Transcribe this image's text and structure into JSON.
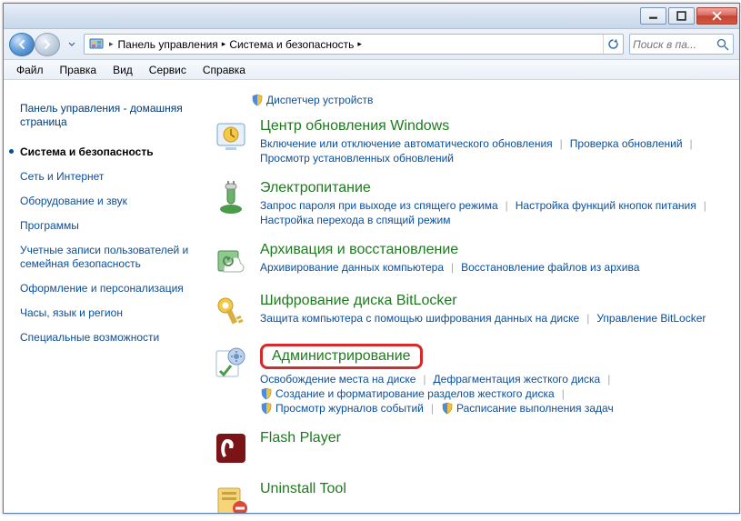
{
  "window": {
    "title": ""
  },
  "nav": {
    "breadcrumb": [
      "Панель управления",
      "Система и безопасность"
    ],
    "search_placeholder": "Поиск в па..."
  },
  "menu": [
    "Файл",
    "Правка",
    "Вид",
    "Сервис",
    "Справка"
  ],
  "sidebar": {
    "home": "Панель управления - домашняя страница",
    "items": [
      {
        "label": "Система и безопасность",
        "active": true
      },
      {
        "label": "Сеть и Интернет"
      },
      {
        "label": "Оборудование и звук"
      },
      {
        "label": "Программы"
      },
      {
        "label": "Учетные записи пользователей и семейная безопасность"
      },
      {
        "label": "Оформление и персонализация"
      },
      {
        "label": "Часы, язык и регион"
      },
      {
        "label": "Специальные возможности"
      }
    ]
  },
  "top_orphan": {
    "shield": true,
    "label": "Диспетчер устройств"
  },
  "categories": [
    {
      "title": "Центр обновления Windows",
      "icon": "windows-update",
      "tasks": [
        {
          "label": "Включение или отключение автоматического обновления"
        },
        {
          "label": "Проверка обновлений"
        },
        {
          "label": "Просмотр установленных обновлений"
        }
      ]
    },
    {
      "title": "Электропитание",
      "icon": "power",
      "tasks": [
        {
          "label": "Запрос пароля при выходе из спящего режима"
        },
        {
          "label": "Настройка функций кнопок питания"
        },
        {
          "label": "Настройка перехода в спящий режим"
        }
      ]
    },
    {
      "title": "Архивация и восстановление",
      "icon": "backup",
      "tasks": [
        {
          "label": "Архивирование данных компьютера"
        },
        {
          "label": "Восстановление файлов из архива"
        }
      ]
    },
    {
      "title": "Шифрование диска BitLocker",
      "icon": "bitlocker",
      "tasks": [
        {
          "label": "Защита компьютера с помощью шифрования данных на диске"
        },
        {
          "label": "Управление BitLocker"
        }
      ]
    },
    {
      "title": "Администрирование",
      "icon": "admin",
      "highlighted": true,
      "tasks": [
        {
          "label": "Освобождение места на диске"
        },
        {
          "label": "Дефрагментация жесткого диска"
        },
        {
          "label": "Создание и форматирование разделов жесткого диска",
          "shield": true
        },
        {
          "label": "Просмотр журналов событий",
          "shield": true
        },
        {
          "label": "Расписание выполнения задач",
          "shield": true
        }
      ]
    },
    {
      "title": "Flash Player",
      "icon": "flash",
      "tasks": []
    },
    {
      "title": "Uninstall Tool",
      "icon": "uninstall",
      "tasks": []
    }
  ]
}
